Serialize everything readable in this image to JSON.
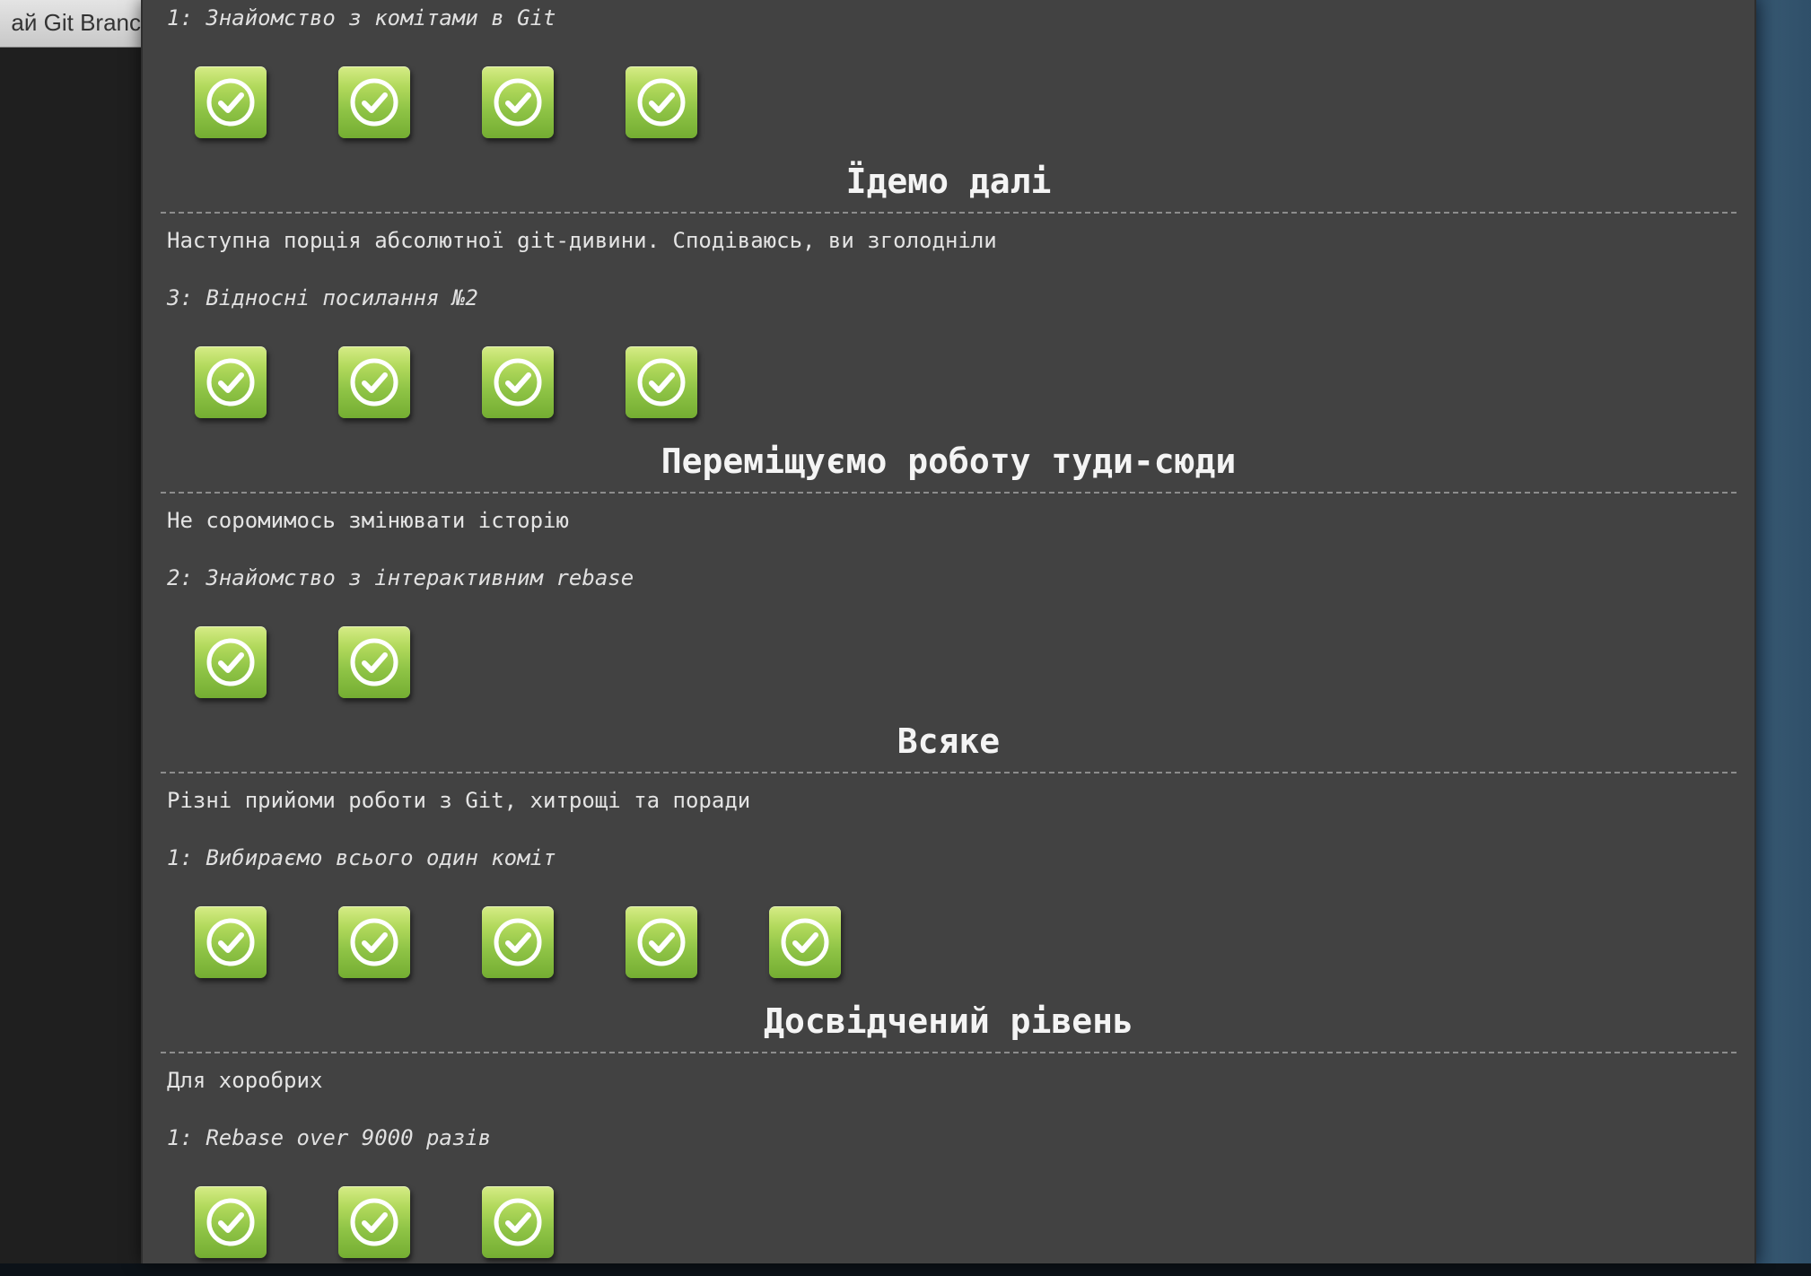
{
  "background_tab": {
    "label": "ай Git Branc"
  },
  "colors": {
    "dialog_bg": "#424242",
    "button_green": "#8fc446",
    "check_white": "#ffffff"
  },
  "sections": [
    {
      "title": "",
      "description": "",
      "levels": [
        {
          "name": "1: Знайомство з комітами в Git",
          "completed_buttons": 4
        }
      ]
    },
    {
      "title": "Їдемо далі",
      "description": "Наступна порція абсолютної git-дивини. Сподіваюсь, ви зголодніли",
      "levels": [
        {
          "name": "3: Відносні посилання №2",
          "completed_buttons": 4
        }
      ]
    },
    {
      "title": "Переміщуємо роботу туди-сюди",
      "description": "Не соромимось змінювати історію",
      "levels": [
        {
          "name": "2: Знайомство з інтерактивним rebase",
          "completed_buttons": 2
        }
      ]
    },
    {
      "title": "Всяке",
      "description": "Різні прийоми роботи з Git, хитрощі та поради",
      "levels": [
        {
          "name": "1: Вибираємо всього один коміт",
          "completed_buttons": 5
        }
      ]
    },
    {
      "title": "Досвідчений рівень",
      "description": "Для хоробрих",
      "levels": [
        {
          "name": "1: Rebase over 9000 разів",
          "completed_buttons": 3
        }
      ]
    }
  ],
  "button_icon": "check-circle-icon"
}
